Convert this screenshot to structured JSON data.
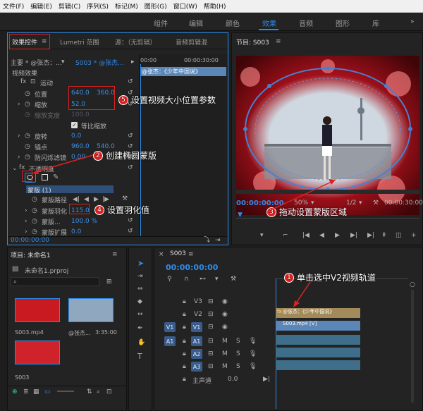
{
  "menu": [
    "文件(F)",
    "编辑(E)",
    "剪辑(C)",
    "序列(S)",
    "标记(M)",
    "图形(G)",
    "窗口(W)",
    "帮助(H)"
  ],
  "workspaces": [
    "组件",
    "编辑",
    "颜色",
    "效果",
    "音频",
    "图形",
    "库"
  ],
  "active_workspace": "效果",
  "effect_panel": {
    "tabs": [
      "效果控件",
      "Lumetri 范围",
      "源：（无剪辑）",
      "音频剪辑混"
    ],
    "master": "主要 * @张杰：...",
    "seq_link": "S003 * @张杰...",
    "tc_start": "00:00",
    "tc_end": "00:00:30:00",
    "clip_label": "@张杰：《少年中国说》",
    "video_effects": "视频效果",
    "motion": "运动",
    "position_label": "位置",
    "position_x": "640.0",
    "position_y": "360.0",
    "scale_label": "缩放",
    "scale": "52.0",
    "scale_width_label": "缩放宽度",
    "scale_width": "100.0",
    "uniform_scale": "等比缩放",
    "rotation_label": "旋转",
    "rotation": "0.0",
    "anchor_label": "锚点",
    "anchor_x": "960.0",
    "anchor_y": "540.0",
    "antiflicker_label": "防闪烁滤镜",
    "antiflicker": "0.00",
    "opacity_label": "不透明度",
    "mask_label": "蒙版 (1)",
    "mask_path": "蒙版路径",
    "mask_feather_label": "蒙版羽化",
    "mask_feather": "115.0",
    "mask_opacity_label": "蒙版...",
    "mask_opacity": "100.0 %",
    "mask_expand_label": "蒙版扩展",
    "mask_expand": "0.0",
    "footer_tc": "00:00:00:00"
  },
  "program": {
    "title": "节目: S003",
    "timecode": "00:00:00:00",
    "zoom": "50%",
    "quality": "1/2",
    "duration": "00:00:30:00"
  },
  "project": {
    "title": "项目: 未命名1",
    "file": "未命名1.prproj",
    "search_placeholder": "",
    "items": [
      {
        "name": "S003.mp4",
        "duration": ""
      },
      {
        "name": "@张杰...",
        "duration": "3:35:00"
      },
      {
        "name": "S003",
        "duration": ""
      }
    ]
  },
  "timeline": {
    "tab": "S003",
    "timecode": "00:00:00:00",
    "tracks_video": [
      "V3",
      "V2",
      "V1"
    ],
    "tracks_audio": [
      "A1",
      "A2",
      "A3"
    ],
    "source_v": "V1",
    "source_a": "A1",
    "master": "主声道",
    "master_val": "0.0",
    "clip_v2": "@张杰：《少年中国说》",
    "clip_v1": "S003.mp4 [V]"
  },
  "callouts": [
    {
      "num": "1",
      "text": "单击选中V2视频轨道"
    },
    {
      "num": "2",
      "text": "创建椭圆蒙版"
    },
    {
      "num": "3",
      "text": "拖动设置蒙版区域"
    },
    {
      "num": "4",
      "text": "设置羽化值"
    },
    {
      "num": "5",
      "text": "设置视频大小位置参数"
    }
  ]
}
